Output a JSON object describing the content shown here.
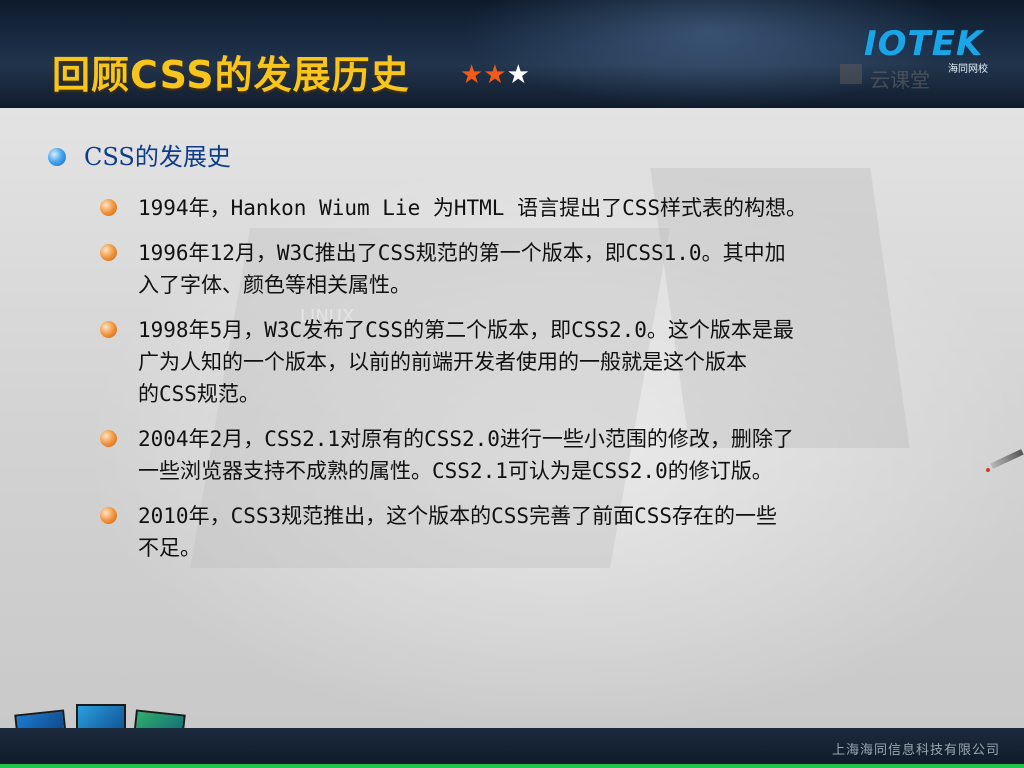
{
  "header": {
    "title": "回顾CSS的发展历史",
    "stars_on": "★★",
    "stars_off": "★",
    "logo_text": "IOTEK",
    "logo_sub": "海同网校",
    "watermark": "云课堂"
  },
  "section": {
    "label": "CSS的发展史"
  },
  "items": [
    {
      "lines": [
        "1994年，Hankon Wium Lie 为HTML 语言提出了CSS样式表的构想。"
      ]
    },
    {
      "lines": [
        "1996年12月，W3C推出了CSS规范的第一个版本，即CSS1.0。其中加",
        "入了字体、颜色等相关属性。"
      ]
    },
    {
      "lines": [
        "1998年5月，W3C发布了CSS的第二个版本，即CSS2.0。这个版本是最",
        "广为人知的一个版本，以前的前端开发者使用的一般就是这个版本",
        "的CSS规范。"
      ]
    },
    {
      "lines": [
        "2004年2月，CSS2.1对原有的CSS2.0进行一些小范围的修改，删除了",
        "一些浏览器支持不成熟的属性。CSS2.1可认为是CSS2.0的修订版。"
      ]
    },
    {
      "lines": [
        "2010年，CSS3规范推出，这个版本的CSS完善了前面CSS存在的一些",
        "不足。"
      ]
    }
  ],
  "background_text": "LINUX",
  "footer": {
    "company": "上海海同信息科技有限公司"
  },
  "colors": {
    "title": "#f7c51c",
    "section_label": "#0d3d8a",
    "bullet_orange": "#f2943c",
    "bullet_blue": "#4aa6ee",
    "footer_strip": "#22c34a"
  }
}
